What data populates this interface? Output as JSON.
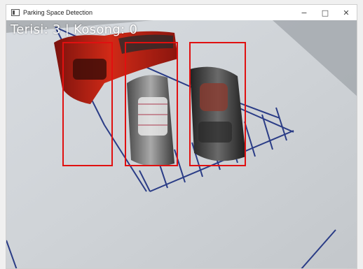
{
  "window": {
    "title": "Parking Space Detection",
    "controls": {
      "minimize": "−",
      "maximize": "□",
      "close": "✕"
    }
  },
  "overlay": {
    "status_text": "Terisi: 3 | Kosong: 0",
    "occupied": 3,
    "empty": 0,
    "box_color": "#e01010"
  },
  "icons": {
    "app": "window-app-icon",
    "minimize": "minimize-icon",
    "maximize": "maximize-icon",
    "close": "close-icon"
  }
}
